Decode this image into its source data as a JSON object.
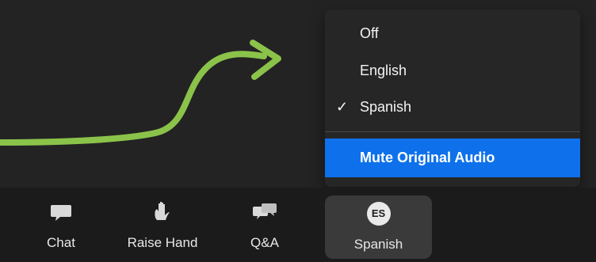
{
  "menu": {
    "items": [
      {
        "label": "Off",
        "checked": false
      },
      {
        "label": "English",
        "checked": false
      },
      {
        "label": "Spanish",
        "checked": true
      },
      {
        "label": "Mute Original Audio",
        "highlighted": true
      }
    ],
    "check_glyph": "✓"
  },
  "toolbar": {
    "chat_label": "Chat",
    "raise_hand_label": "Raise Hand",
    "qa_label": "Q&A",
    "language_label": "Spanish",
    "language_badge": "ES"
  },
  "colors": {
    "background": "#232323",
    "toolbar": "#1b1b1b",
    "menu": "#262626",
    "highlight": "#0e71eb",
    "arrow": "#8bc34a"
  },
  "icons": {
    "arrow": "curved-arrow-icon",
    "chat": "chat-bubble-icon",
    "raise_hand": "hand-icon",
    "qa": "qa-bubbles-icon",
    "language": "language-badge-icon"
  }
}
